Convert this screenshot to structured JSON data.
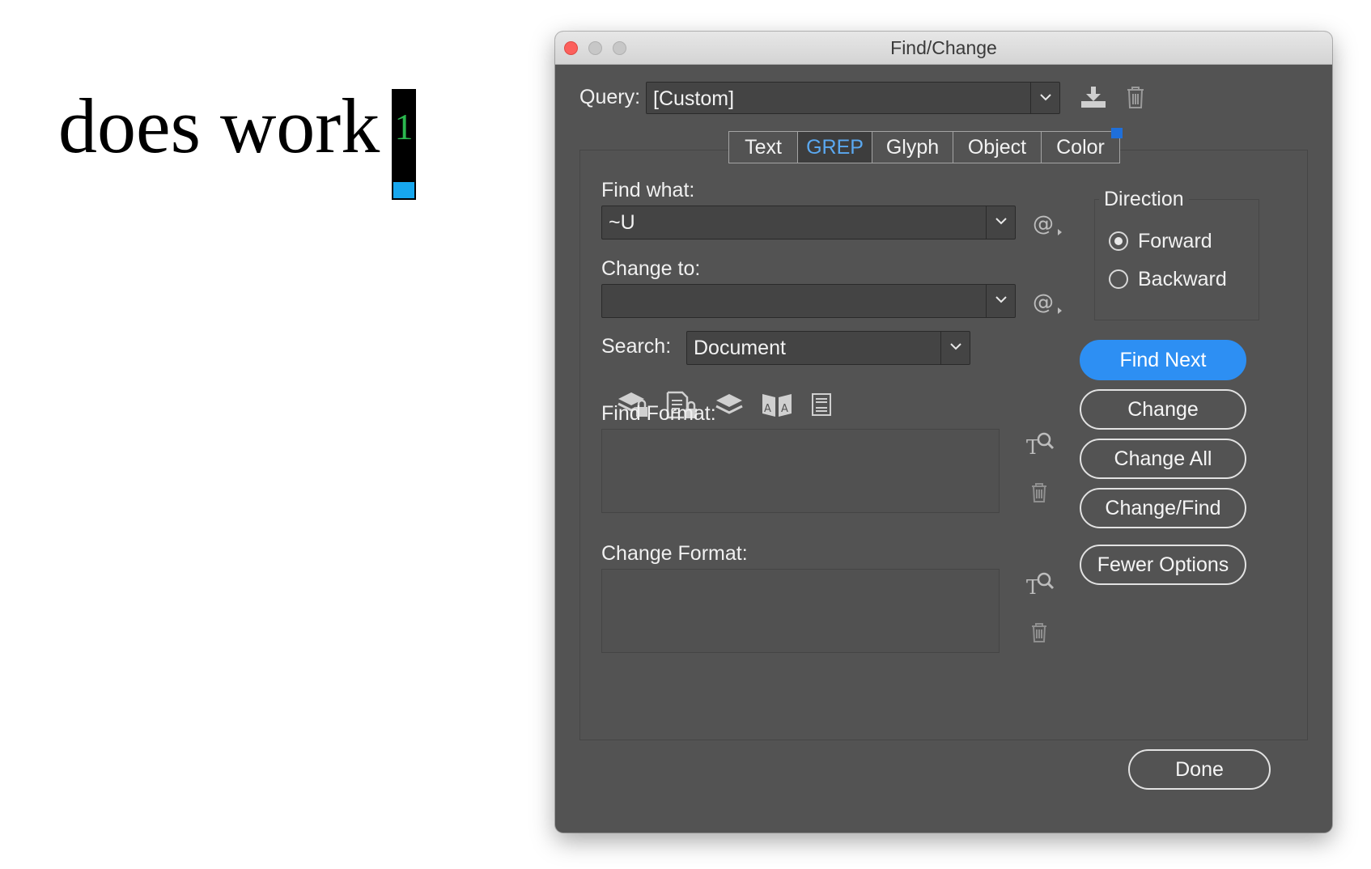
{
  "document": {
    "text": "does work",
    "marker_number": "1"
  },
  "dialog": {
    "title": "Find/Change",
    "query": {
      "label": "Query:",
      "value": "[Custom]"
    },
    "tabs": [
      {
        "label": "Text",
        "active": false
      },
      {
        "label": "GREP",
        "active": true
      },
      {
        "label": "Glyph",
        "active": false
      },
      {
        "label": "Object",
        "active": false
      },
      {
        "label": "Color",
        "active": false
      }
    ],
    "find_what": {
      "label": "Find what:",
      "value": "~U"
    },
    "change_to": {
      "label": "Change to:",
      "value": ""
    },
    "search": {
      "label": "Search:",
      "value": "Document"
    },
    "find_format": {
      "label": "Find Format:"
    },
    "change_format": {
      "label": "Change Format:"
    },
    "direction": {
      "label": "Direction",
      "options": [
        {
          "label": "Forward",
          "selected": true
        },
        {
          "label": "Backward",
          "selected": false
        }
      ]
    },
    "buttons": {
      "find_next": "Find Next",
      "change": "Change",
      "change_all": "Change All",
      "change_find": "Change/Find",
      "fewer_options": "Fewer Options",
      "done": "Done"
    },
    "icons": {
      "query_save": "save-query-icon",
      "query_delete": "trash-icon",
      "special_chars": "at-sign-icon",
      "search_options": [
        "locked-layers-icon",
        "locked-stories-icon",
        "hidden-layers-icon",
        "master-pages-icon",
        "footnotes-icon"
      ],
      "format": "format-magnifier-icon"
    },
    "colors": {
      "dialog_bg": "#535353",
      "active_tab_text": "#5aa8f0",
      "primary_button": "#2d8ff3"
    }
  }
}
